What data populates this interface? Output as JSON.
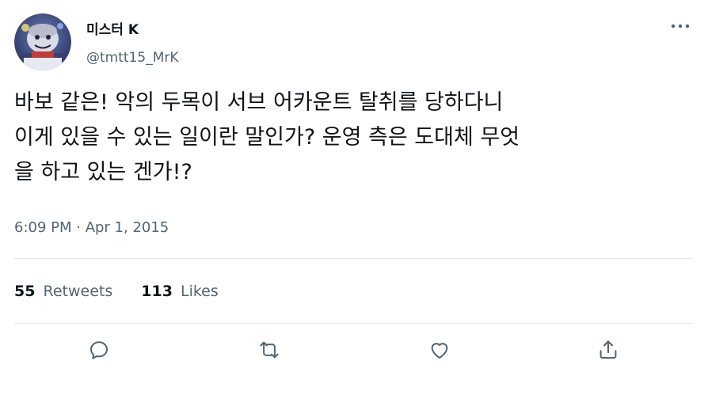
{
  "user": {
    "display_name": "미스터 K",
    "handle": "@tmtt15_MrK"
  },
  "tweet": {
    "text": "바보 같은! 악의 두목이 서브 어카운트 탈취를 당하다니\n이게 있을 수 있는 일이란 말인가? 운영 측은 도대체 무엇\n을 하고 있는 겐가!?",
    "timestamp": "6:09 PM · Apr 1, 2015"
  },
  "stats": {
    "retweets_count": "55",
    "retweets_label": "Retweets",
    "likes_count": "113",
    "likes_label": "Likes"
  },
  "icons": {
    "more": "more-horizontal-icon",
    "reply": "reply-icon",
    "retweet": "retweet-icon",
    "like": "heart-icon",
    "share": "share-icon"
  },
  "colors": {
    "text_primary": "#0f1419",
    "text_secondary": "#536471",
    "divider": "#e1e8ed"
  }
}
